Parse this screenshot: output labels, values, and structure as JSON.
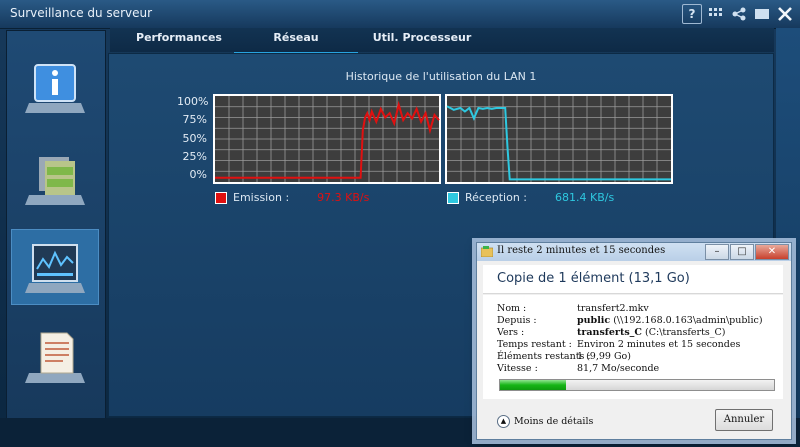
{
  "window": {
    "title": "Surveillance du serveur"
  },
  "titlebar_icons": [
    "help-icon",
    "network-icon",
    "share-icon",
    "minimize-icon",
    "close-icon"
  ],
  "titlebar_help_label": "?",
  "sidebar": {
    "items": [
      {
        "name": "info",
        "icon": "info-monitor-icon"
      },
      {
        "name": "storage",
        "icon": "hard-drive-icon"
      },
      {
        "name": "monitor",
        "icon": "resource-monitor-icon",
        "active": true
      },
      {
        "name": "log",
        "icon": "document-log-icon"
      }
    ]
  },
  "tabs": [
    {
      "label": "Performances"
    },
    {
      "label": "Réseau",
      "active": true
    },
    {
      "label": "Util. Processeur"
    }
  ],
  "chart": {
    "title": "Historique de l'utilisation du LAN 1",
    "y_ticks": [
      "100%",
      "75%",
      "50%",
      "25%",
      "0%"
    ],
    "emission": {
      "label": "Emission :",
      "value": "97.3 KB/s",
      "color": "#e01010"
    },
    "reception": {
      "label": "Réception :",
      "value": "681.4 KB/s",
      "color": "#2ec8e0"
    }
  },
  "chart_data": [
    {
      "type": "line",
      "series": [
        {
          "name": "Emission",
          "color": "#e01010",
          "x": [
            0,
            5,
            10,
            15,
            20,
            25,
            30,
            35,
            40,
            45,
            50,
            55,
            60,
            65,
            66,
            67,
            68,
            69,
            70,
            72,
            74,
            76,
            78,
            80,
            82,
            84,
            86,
            88,
            90,
            92,
            94,
            96,
            98,
            100
          ],
          "values": [
            5,
            5,
            5,
            5,
            5,
            5,
            5,
            5,
            5,
            5,
            5,
            5,
            5,
            5,
            60,
            75,
            80,
            72,
            82,
            70,
            85,
            75,
            80,
            68,
            90,
            72,
            80,
            74,
            85,
            70,
            80,
            60,
            78,
            72
          ]
        }
      ],
      "ylim": [
        0,
        100
      ],
      "ylabel": ""
    },
    {
      "type": "line",
      "series": [
        {
          "name": "Réception",
          "color": "#2ec8e0",
          "x": [
            0,
            3,
            6,
            8,
            10,
            12,
            14,
            16,
            18,
            20,
            22,
            24,
            26,
            27,
            28,
            30,
            40,
            50,
            60,
            70,
            80,
            90,
            100
          ],
          "values": [
            88,
            84,
            86,
            82,
            86,
            74,
            86,
            85,
            86,
            85,
            86,
            86,
            86,
            40,
            3,
            3,
            3,
            3,
            3,
            3,
            3,
            3,
            3
          ]
        }
      ],
      "ylim": [
        0,
        100
      ],
      "ylabel": ""
    }
  ],
  "dialog": {
    "title": "Il reste 2 minutes et 15 secondes",
    "header": "Copie de 1 élément (13,1 Go)",
    "fields": [
      {
        "label": "Nom :",
        "bold": "",
        "value": "transfert2.mkv"
      },
      {
        "label": "Depuis :",
        "bold": "public",
        "value": " (\\\\192.168.0.163\\admin\\public)"
      },
      {
        "label": "Vers :",
        "bold": "transferts_C",
        "value": " (C:\\transferts_C)"
      },
      {
        "label": "Temps restant :",
        "bold": "",
        "value": "Environ 2 minutes et 15 secondes"
      },
      {
        "label": "Éléments restants :",
        "bold": "",
        "value": "1 (9,99 Go)"
      },
      {
        "label": "Vitesse :",
        "bold": "",
        "value": "81,7 Mo/seconde"
      }
    ],
    "progress": 0.24,
    "less_details": "Moins de détails",
    "cancel": "Annuler",
    "btn_min": "–",
    "btn_max": "□",
    "btn_close": "✕"
  }
}
